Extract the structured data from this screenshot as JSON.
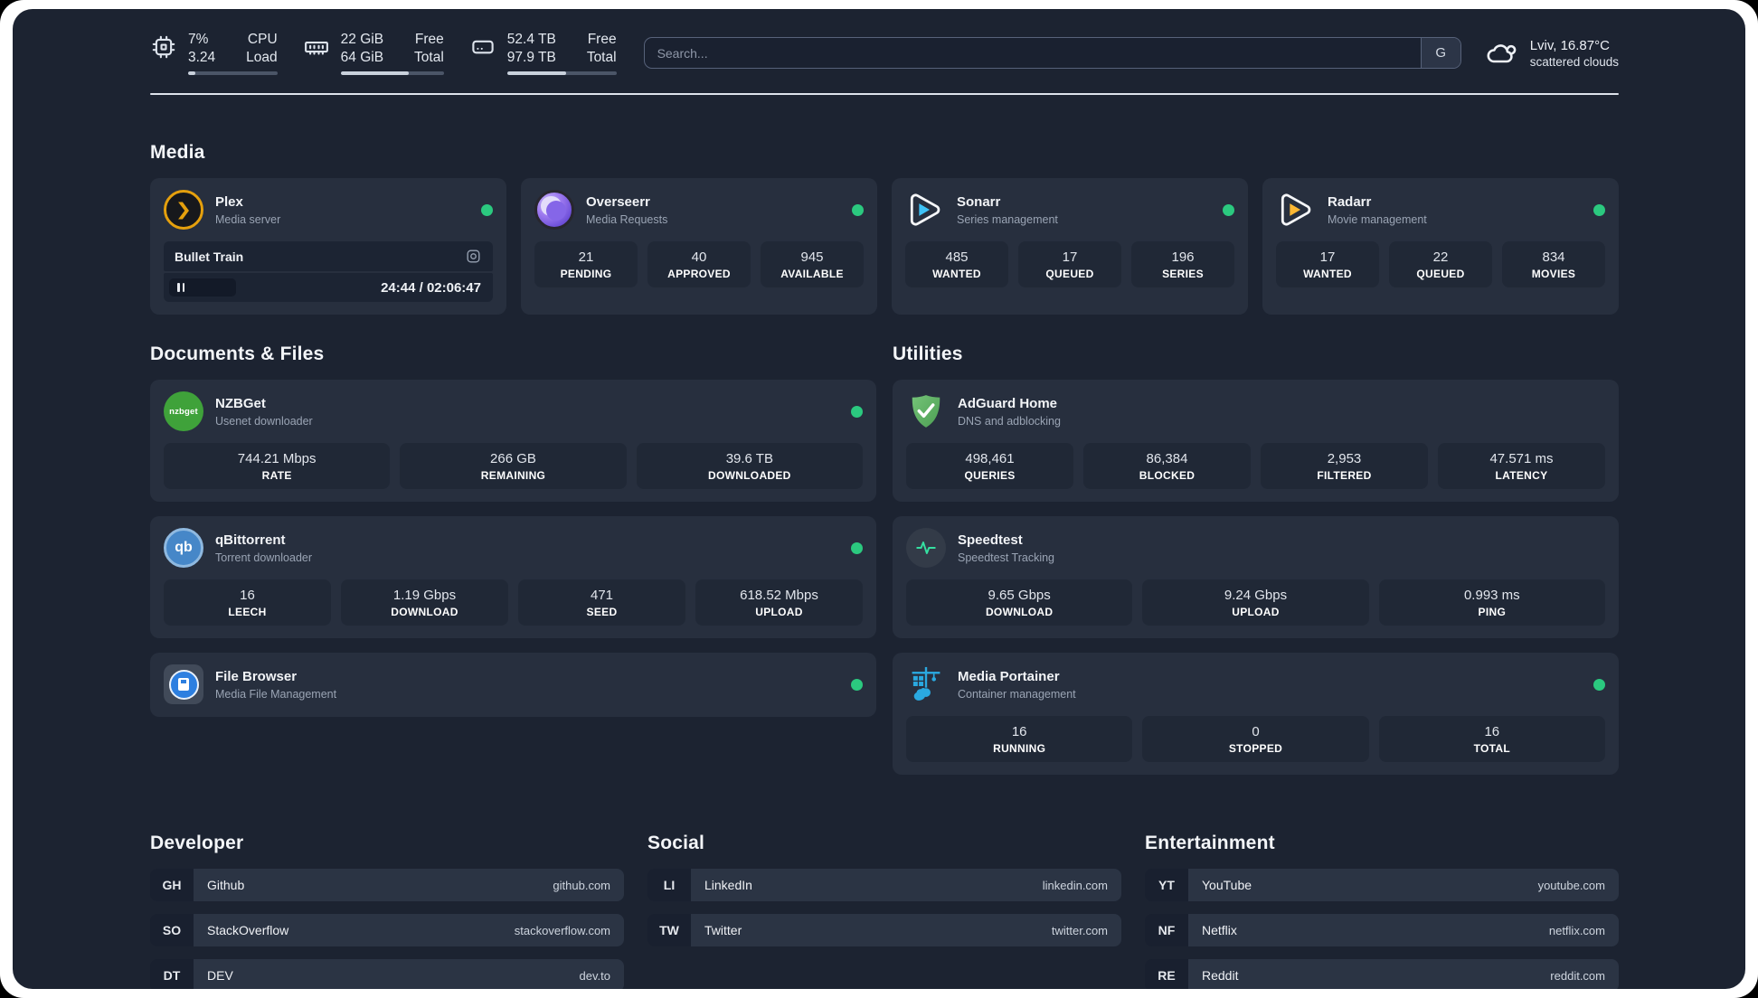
{
  "colors": {
    "status_online": "#2bc97f",
    "panel_background": "#1c2331",
    "card_background": "#272f3e",
    "plex_accent": "#e5a00d"
  },
  "header": {
    "metrics": [
      {
        "icon": "cpu-icon",
        "value_top": "7%",
        "value_bottom": "3.24",
        "label_top": "CPU",
        "label_bottom": "Load",
        "progress_pct": 8
      },
      {
        "icon": "ram-icon",
        "value_top": "22 GiB",
        "value_bottom": "64 GiB",
        "label_top": "Free",
        "label_bottom": "Total",
        "progress_pct": 66
      },
      {
        "icon": "disk-icon",
        "value_top": "52.4 TB",
        "value_bottom": "97.9 TB",
        "label_top": "Free",
        "label_bottom": "Total",
        "progress_pct": 54
      }
    ],
    "search": {
      "placeholder": "Search...",
      "engine": "G"
    },
    "weather": {
      "location": "Lviv, 16.87°C",
      "condition": "scattered clouds"
    }
  },
  "categories": [
    {
      "title": "Media",
      "apps": [
        {
          "name": "Plex",
          "description": "Media server",
          "icon": "plex-icon",
          "online": true,
          "player": {
            "title": "Bullet Train",
            "time": "24:44 / 02:06:47"
          }
        },
        {
          "name": "Overseerr",
          "description": "Media Requests",
          "icon": "overseerr-icon",
          "online": true,
          "stats": [
            {
              "value": "21",
              "label": "PENDING"
            },
            {
              "value": "40",
              "label": "APPROVED"
            },
            {
              "value": "945",
              "label": "AVAILABLE"
            }
          ]
        },
        {
          "name": "Sonarr",
          "description": "Series management",
          "icon": "sonarr-icon",
          "online": true,
          "stats": [
            {
              "value": "485",
              "label": "WANTED"
            },
            {
              "value": "17",
              "label": "QUEUED"
            },
            {
              "value": "196",
              "label": "SERIES"
            }
          ]
        },
        {
          "name": "Radarr",
          "description": "Movie management",
          "icon": "radarr-icon",
          "online": true,
          "stats": [
            {
              "value": "17",
              "label": "WANTED"
            },
            {
              "value": "22",
              "label": "QUEUED"
            },
            {
              "value": "834",
              "label": "MOVIES"
            }
          ]
        }
      ]
    },
    {
      "title": "Documents & Files",
      "apps": [
        {
          "name": "NZBGet",
          "description": "Usenet downloader",
          "icon": "nzbget-icon",
          "online": true,
          "stats": [
            {
              "value": "744.21 Mbps",
              "label": "RATE"
            },
            {
              "value": "266 GB",
              "label": "REMAINING"
            },
            {
              "value": "39.6 TB",
              "label": "DOWNLOADED"
            }
          ]
        },
        {
          "name": "qBittorrent",
          "description": "Torrent downloader",
          "icon": "qbittorrent-icon",
          "online": true,
          "stats": [
            {
              "value": "16",
              "label": "LEECH"
            },
            {
              "value": "1.19 Gbps",
              "label": "DOWNLOAD"
            },
            {
              "value": "471",
              "label": "SEED"
            },
            {
              "value": "618.52 Mbps",
              "label": "UPLOAD"
            }
          ]
        },
        {
          "name": "File Browser",
          "description": "Media File Management",
          "icon": "filebrowser-icon",
          "online": true
        }
      ]
    },
    {
      "title": "Utilities",
      "apps": [
        {
          "name": "AdGuard Home",
          "description": "DNS and adblocking",
          "icon": "adguard-icon",
          "online": false,
          "stats": [
            {
              "value": "498,461",
              "label": "QUERIES"
            },
            {
              "value": "86,384",
              "label": "BLOCKED"
            },
            {
              "value": "2,953",
              "label": "FILTERED"
            },
            {
              "value": "47.571 ms",
              "label": "LATENCY"
            }
          ]
        },
        {
          "name": "Speedtest",
          "description": "Speedtest Tracking",
          "icon": "speedtest-icon",
          "online": false,
          "stats": [
            {
              "value": "9.65 Gbps",
              "label": "DOWNLOAD"
            },
            {
              "value": "9.24 Gbps",
              "label": "UPLOAD"
            },
            {
              "value": "0.993 ms",
              "label": "PING"
            }
          ]
        },
        {
          "name": "Media Portainer",
          "description": "Container management",
          "icon": "portainer-icon",
          "online": true,
          "stats": [
            {
              "value": "16",
              "label": "RUNNING"
            },
            {
              "value": "0",
              "label": "STOPPED"
            },
            {
              "value": "16",
              "label": "TOTAL"
            }
          ]
        }
      ]
    }
  ],
  "link_sections": [
    {
      "title": "Developer",
      "links": [
        {
          "tag": "GH",
          "name": "Github",
          "url": "github.com"
        },
        {
          "tag": "SO",
          "name": "StackOverflow",
          "url": "stackoverflow.com"
        },
        {
          "tag": "DT",
          "name": "DEV",
          "url": "dev.to"
        }
      ]
    },
    {
      "title": "Social",
      "links": [
        {
          "tag": "LI",
          "name": "LinkedIn",
          "url": "linkedin.com"
        },
        {
          "tag": "TW",
          "name": "Twitter",
          "url": "twitter.com"
        }
      ]
    },
    {
      "title": "Entertainment",
      "links": [
        {
          "tag": "YT",
          "name": "YouTube",
          "url": "youtube.com"
        },
        {
          "tag": "NF",
          "name": "Netflix",
          "url": "netflix.com"
        },
        {
          "tag": "RE",
          "name": "Reddit",
          "url": "reddit.com"
        }
      ]
    }
  ]
}
